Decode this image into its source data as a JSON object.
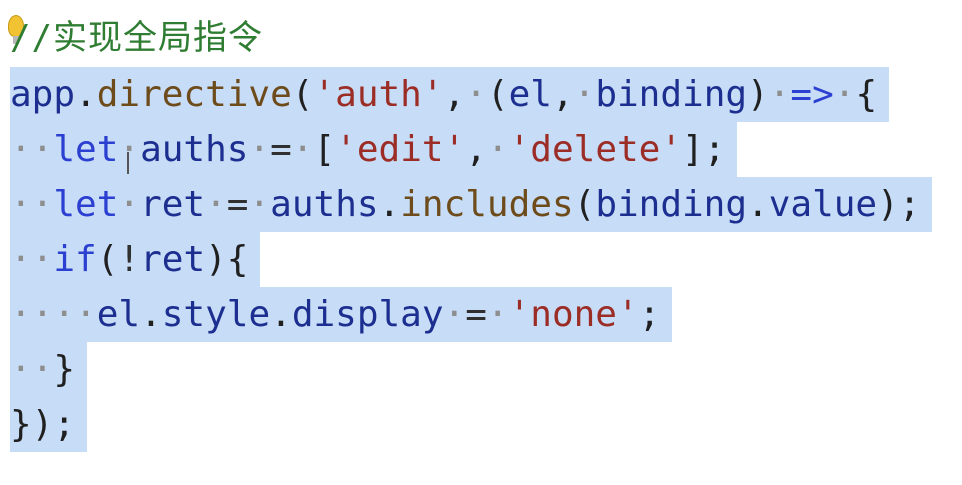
{
  "editor": {
    "comment": "//实现全局指令",
    "lines": [
      {
        "parts": [
          {
            "t": "app",
            "c": "var"
          },
          {
            "t": ".",
            "c": "punc"
          },
          {
            "t": "directive",
            "c": "fn"
          },
          {
            "t": "(",
            "c": "punc"
          },
          {
            "t": "'auth'",
            "c": "str"
          },
          {
            "t": ",",
            "c": "punc"
          },
          {
            "t": "·",
            "c": "ws"
          },
          {
            "t": "(",
            "c": "punc"
          },
          {
            "t": "el",
            "c": "var"
          },
          {
            "t": ",",
            "c": "punc"
          },
          {
            "t": "·",
            "c": "ws"
          },
          {
            "t": "binding",
            "c": "var"
          },
          {
            "t": ")",
            "c": "punc"
          },
          {
            "t": "·",
            "c": "ws"
          },
          {
            "t": "=>",
            "c": "kw"
          },
          {
            "t": "·",
            "c": "ws"
          },
          {
            "t": "{",
            "c": "punc"
          }
        ]
      },
      {
        "parts": [
          {
            "t": "··",
            "c": "ws"
          },
          {
            "t": "let",
            "c": "kw"
          },
          {
            "t": "·",
            "c": "ws"
          },
          {
            "t": "auths",
            "c": "var"
          },
          {
            "t": "·",
            "c": "ws"
          },
          {
            "t": "=",
            "c": "op"
          },
          {
            "t": "·",
            "c": "ws"
          },
          {
            "t": "[",
            "c": "punc"
          },
          {
            "t": "'edit'",
            "c": "str"
          },
          {
            "t": ",",
            "c": "punc"
          },
          {
            "t": "·",
            "c": "ws"
          },
          {
            "t": "'delete'",
            "c": "str"
          },
          {
            "t": "];",
            "c": "punc"
          }
        ]
      },
      {
        "parts": [
          {
            "t": "··",
            "c": "ws"
          },
          {
            "t": "let",
            "c": "kw"
          },
          {
            "t": "·",
            "c": "ws"
          },
          {
            "t": "ret",
            "c": "var"
          },
          {
            "t": "·",
            "c": "ws"
          },
          {
            "t": "=",
            "c": "op"
          },
          {
            "t": "·",
            "c": "ws"
          },
          {
            "t": "auths",
            "c": "var"
          },
          {
            "t": ".",
            "c": "punc"
          },
          {
            "t": "includes",
            "c": "fn"
          },
          {
            "t": "(",
            "c": "punc"
          },
          {
            "t": "binding",
            "c": "var"
          },
          {
            "t": ".",
            "c": "punc"
          },
          {
            "t": "value",
            "c": "var"
          },
          {
            "t": ");",
            "c": "punc"
          }
        ]
      },
      {
        "parts": [
          {
            "t": "··",
            "c": "ws"
          },
          {
            "t": "if",
            "c": "kw"
          },
          {
            "t": "(",
            "c": "punc"
          },
          {
            "t": "!",
            "c": "op"
          },
          {
            "t": "ret",
            "c": "var"
          },
          {
            "t": "){",
            "c": "punc"
          }
        ]
      },
      {
        "parts": [
          {
            "t": "····",
            "c": "ws"
          },
          {
            "t": "el",
            "c": "var"
          },
          {
            "t": ".",
            "c": "punc"
          },
          {
            "t": "style",
            "c": "var"
          },
          {
            "t": ".",
            "c": "punc"
          },
          {
            "t": "display",
            "c": "var"
          },
          {
            "t": "·",
            "c": "ws"
          },
          {
            "t": "=",
            "c": "op"
          },
          {
            "t": "·",
            "c": "ws"
          },
          {
            "t": "'none'",
            "c": "str"
          },
          {
            "t": ";",
            "c": "punc"
          }
        ]
      },
      {
        "parts": [
          {
            "t": "··",
            "c": "ws"
          },
          {
            "t": "}",
            "c": "punc"
          }
        ]
      },
      {
        "parts": [
          {
            "t": "});",
            "c": "punc"
          }
        ]
      }
    ]
  }
}
